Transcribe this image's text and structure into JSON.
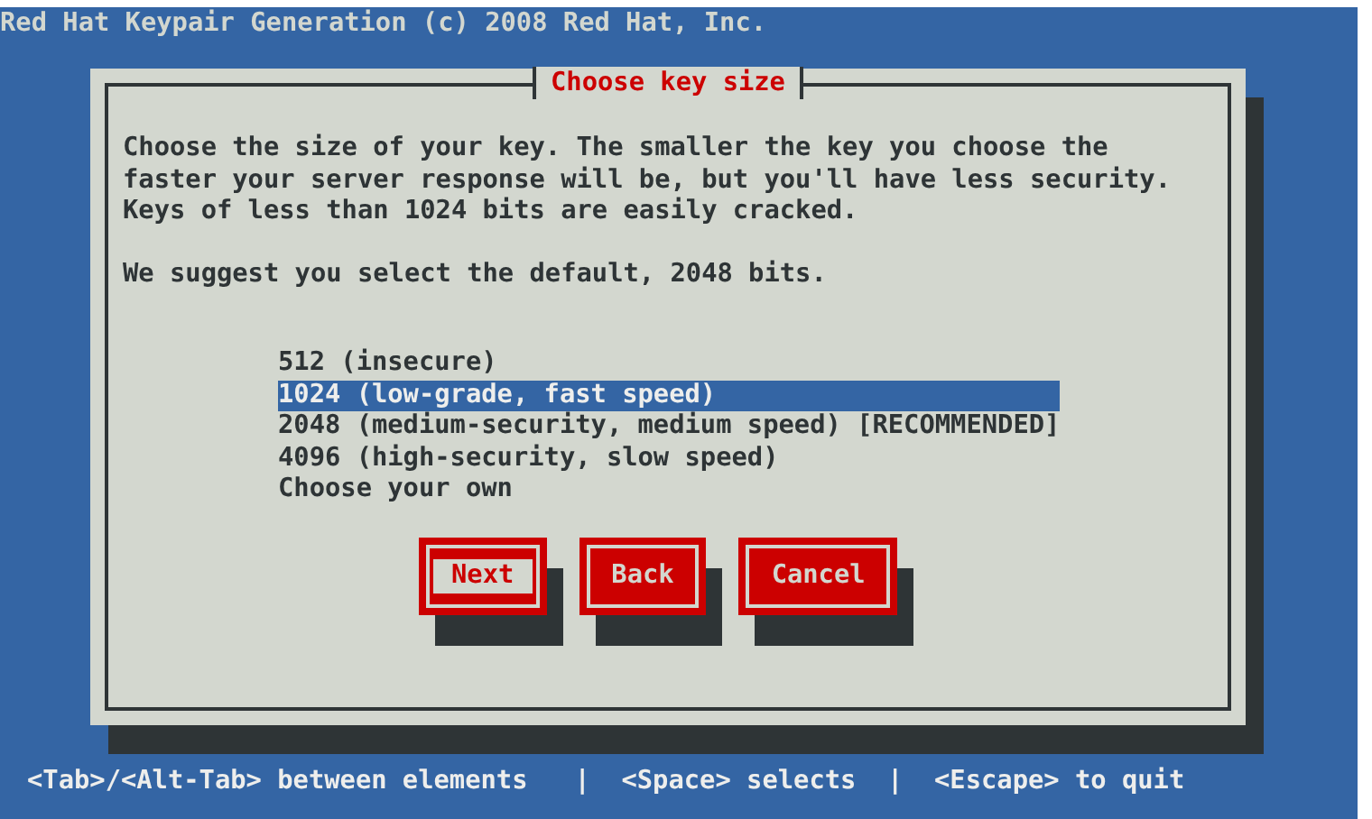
{
  "window": {
    "title": "Red Hat Keypair Generation (c) 2008 Red Hat, Inc."
  },
  "dialog": {
    "title": "Choose key size",
    "paragraphs": [
      "Choose the size of your key. The smaller the key you choose the faster your server response will be, but you'll have less security. Keys of less than 1024 bits are easily cracked.",
      "We suggest you select the default, 2048 bits."
    ],
    "options": [
      {
        "label": "512 (insecure)",
        "selected": false
      },
      {
        "label": "1024 (low-grade, fast speed)",
        "selected": true
      },
      {
        "label": "2048 (medium-security, medium speed) [RECOMMENDED]",
        "selected": false
      },
      {
        "label": "4096 (high-security, slow speed)",
        "selected": false
      },
      {
        "label": "Choose your own",
        "selected": false
      }
    ],
    "buttons": [
      {
        "label": "Next",
        "selected": true
      },
      {
        "label": "Back",
        "selected": false
      },
      {
        "label": "Cancel",
        "selected": false
      }
    ]
  },
  "status_bar": "<Tab>/<Alt-Tab> between elements   |  <Space> selects  |  <Escape> to quit"
}
